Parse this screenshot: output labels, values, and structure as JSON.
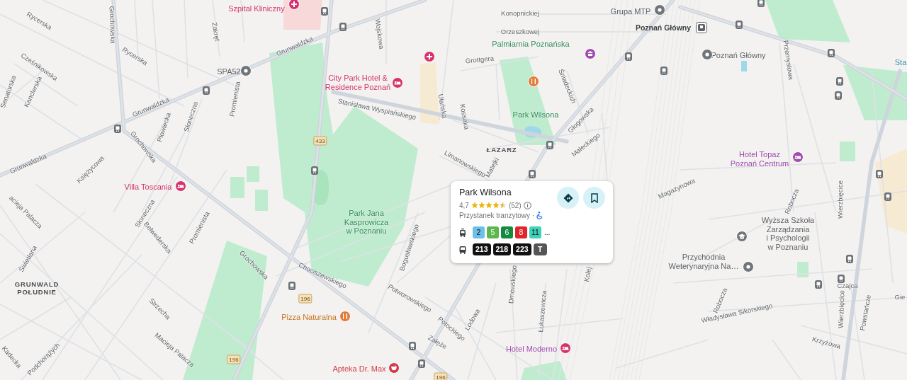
{
  "map": {
    "labels": [
      {
        "kind": "street",
        "lines": [
          "Rycerska"
        ]
      },
      {
        "kind": "street",
        "lines": [
          "Rycerska"
        ]
      },
      {
        "kind": "street",
        "lines": [
          "Grochowska"
        ]
      },
      {
        "kind": "street",
        "lines": [
          "Zakręt"
        ]
      },
      {
        "kind": "street",
        "lines": [
          "Grunwaldzka"
        ]
      },
      {
        "kind": "street",
        "lines": [
          "Grunwaldzka"
        ]
      },
      {
        "kind": "street",
        "lines": [
          "Grunwaldzka"
        ]
      },
      {
        "kind": "street",
        "lines": [
          "Cześnikowska"
        ]
      },
      {
        "kind": "street",
        "lines": [
          "Kanclerska"
        ]
      },
      {
        "kind": "street",
        "lines": [
          "Senatorska"
        ]
      },
      {
        "kind": "street",
        "lines": [
          "Promienista"
        ]
      },
      {
        "kind": "street",
        "lines": [
          "Płowiecka"
        ]
      },
      {
        "kind": "street",
        "lines": [
          "Słoneczna"
        ]
      },
      {
        "kind": "street",
        "lines": [
          "Grochowska"
        ]
      },
      {
        "kind": "street",
        "lines": [
          "Księżycowa"
        ]
      },
      {
        "kind": "street",
        "lines": [
          "Stanisława Wyspiańskiego"
        ]
      },
      {
        "kind": "street",
        "lines": [
          "Wojskowa"
        ]
      },
      {
        "kind": "street",
        "lines": [
          "Ułańska"
        ]
      },
      {
        "kind": "street",
        "lines": [
          "Grottgera"
        ]
      },
      {
        "kind": "street",
        "lines": [
          "Konopnickiej"
        ]
      },
      {
        "kind": "street",
        "lines": [
          "Orzeszkowej"
        ]
      },
      {
        "kind": "street",
        "lines": [
          "Kossaka"
        ]
      },
      {
        "kind": "street",
        "lines": [
          "Śniadeckich"
        ]
      },
      {
        "kind": "street",
        "lines": [
          "Głogowska"
        ]
      },
      {
        "kind": "street",
        "lines": [
          "Małeckiego"
        ]
      },
      {
        "kind": "street",
        "lines": [
          "Limanowskiego"
        ]
      },
      {
        "kind": "street",
        "lines": [
          "Matejki"
        ]
      },
      {
        "kind": "street",
        "lines": [
          "Przemysłowa"
        ]
      },
      {
        "kind": "street",
        "lines": [
          "Magazynowa"
        ]
      },
      {
        "kind": "street",
        "lines": [
          "Robocza"
        ]
      },
      {
        "kind": "street",
        "lines": [
          "Wierzbięcice"
        ]
      },
      {
        "kind": "street",
        "lines": [
          "acieja Palacza"
        ]
      },
      {
        "kind": "street",
        "lines": [
          "Słoneczna"
        ]
      },
      {
        "kind": "street",
        "lines": [
          "Promienista"
        ]
      },
      {
        "kind": "street",
        "lines": [
          "Belwederska"
        ]
      },
      {
        "kind": "street",
        "lines": [
          "Świetlana"
        ]
      },
      {
        "kind": "street",
        "lines": [
          "Grochowska"
        ]
      },
      {
        "kind": "street",
        "lines": [
          "Strzecha"
        ]
      },
      {
        "kind": "street",
        "lines": [
          "Chociszewskiego"
        ]
      },
      {
        "kind": "street",
        "lines": [
          "Bogusławskiego"
        ]
      },
      {
        "kind": "street",
        "lines": [
          "Potworowskiego"
        ]
      },
      {
        "kind": "street",
        "lines": [
          "Dmowskiego"
        ]
      },
      {
        "kind": "street",
        "lines": [
          "Łukaszewicza"
        ]
      },
      {
        "kind": "street",
        "lines": [
          "Lodowa"
        ]
      },
      {
        "kind": "street",
        "lines": [
          "Potockiego"
        ]
      },
      {
        "kind": "street",
        "lines": [
          "Załęże"
        ]
      },
      {
        "kind": "street",
        "lines": [
          "Kadecka"
        ]
      },
      {
        "kind": "street",
        "lines": [
          "Podchorążych"
        ]
      },
      {
        "kind": "street",
        "lines": [
          "Macieja Palacza"
        ]
      },
      {
        "kind": "street",
        "lines": [
          "Władysława Sikorskiego"
        ]
      },
      {
        "kind": "street",
        "lines": [
          "Czajca"
        ]
      },
      {
        "kind": "street",
        "lines": [
          "Robocza"
        ]
      },
      {
        "kind": "street",
        "lines": [
          "Powstańcze"
        ]
      },
      {
        "kind": "street",
        "lines": [
          "Wierzbięcice"
        ]
      },
      {
        "kind": "street",
        "lines": [
          "Krzyżowa"
        ]
      },
      {
        "kind": "street",
        "lines": [
          "Kolej"
        ]
      },
      {
        "kind": "poi",
        "color": "#d6336c",
        "lines": [
          "Szpital Kliniczny"
        ]
      },
      {
        "kind": "poi",
        "color": "#5f6368",
        "lines": [
          "SPA52"
        ]
      },
      {
        "kind": "poi",
        "color": "#d6336c",
        "lines": [
          "City Park Hotel &",
          "Residence Poznań"
        ]
      },
      {
        "kind": "park",
        "lines": [
          "Palmiarnia Poznańska"
        ]
      },
      {
        "kind": "poi",
        "color": "#5f6368",
        "lines": [
          "Grupa MTP"
        ]
      },
      {
        "kind": "station",
        "lines": [
          "Poznań Główny"
        ]
      },
      {
        "kind": "poi",
        "color": "#5f6368",
        "lines": [
          "Poznań Główny"
        ]
      },
      {
        "kind": "park",
        "lines": [
          "Park Wilsona"
        ]
      },
      {
        "kind": "district",
        "lines": [
          "ŁAZARZ"
        ]
      },
      {
        "kind": "poi",
        "color": "#a14cb0",
        "lines": [
          "Hotel Topaz",
          "Poznań Centrum"
        ]
      },
      {
        "kind": "poi",
        "color": "#d6336c",
        "lines": [
          "Villa Toscania"
        ]
      },
      {
        "kind": "park",
        "lines": [
          "Park Jana",
          "Kasprowicza",
          "w Poznaniu"
        ]
      },
      {
        "kind": "district",
        "lines": [
          "GRUNWALD",
          "POŁUDNIE"
        ]
      },
      {
        "kind": "poi",
        "color": "#c5741f",
        "lines": [
          "Pizza Naturalna"
        ]
      },
      {
        "kind": "poi",
        "color": "#d33c4a",
        "lines": [
          "Apteka Dr. Max"
        ]
      },
      {
        "kind": "poi",
        "color": "#a14cb0",
        "lines": [
          "Hotel Moderno"
        ]
      },
      {
        "kind": "poi",
        "color": "#5f6368",
        "lines": [
          "Wyższa Szkoła",
          "Zarządzania",
          "i Psychologii",
          "w Poznaniu"
        ]
      },
      {
        "kind": "poi",
        "color": "#5f6368",
        "lines": [
          "Przychodnia",
          "Weterynaryjna Na…"
        ]
      },
      {
        "kind": "poi",
        "color": "#3d8fb8",
        "lines": [
          "Sta"
        ]
      },
      {
        "kind": "street",
        "lines": [
          "Gie"
        ]
      },
      {
        "kind": "shield",
        "lines": [
          "433"
        ]
      },
      {
        "kind": "shield",
        "lines": [
          "196"
        ]
      },
      {
        "kind": "shield",
        "lines": [
          "196"
        ]
      },
      {
        "kind": "shield",
        "lines": [
          "196"
        ]
      }
    ]
  },
  "place_card": {
    "title": "Park Wilsona",
    "rating": "4,7",
    "stars": 4.5,
    "reviews": "(52)",
    "category": "Przystanek tranzytowy",
    "separator": "·",
    "transit": [
      {
        "kind": "tram",
        "more": "...",
        "lines": [
          {
            "label": "2",
            "color": "#6cc1e8"
          },
          {
            "label": "5",
            "color": "#5cb84c"
          },
          {
            "label": "6",
            "color": "#138a3f"
          },
          {
            "label": "8",
            "color": "#e0262b"
          },
          {
            "label": "11",
            "color": "#40d1b8"
          }
        ]
      },
      {
        "kind": "bus",
        "lines": [
          {
            "label": "213",
            "color": "#111111"
          },
          {
            "label": "218",
            "color": "#111111"
          },
          {
            "label": "223",
            "color": "#111111"
          },
          {
            "label": "T",
            "color": "#555555"
          }
        ]
      }
    ]
  }
}
